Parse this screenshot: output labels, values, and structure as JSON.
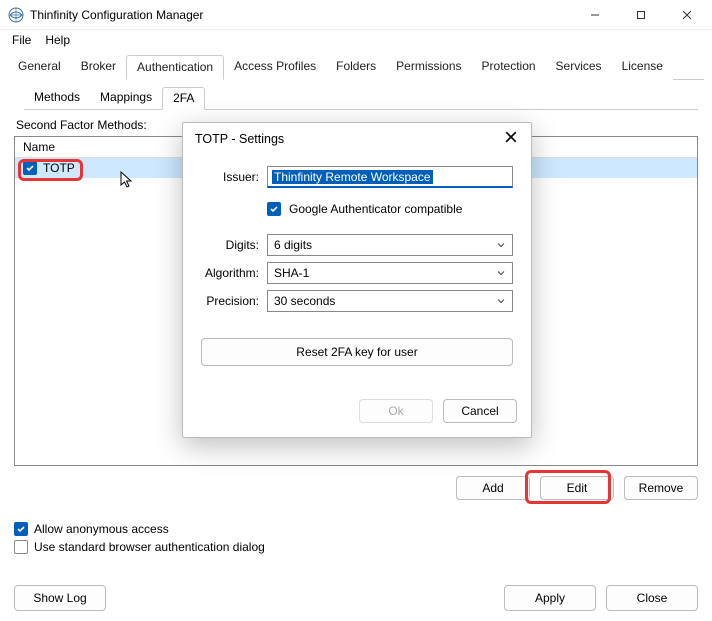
{
  "window": {
    "title": "Thinfinity Configuration Manager"
  },
  "menubar": {
    "file": "File",
    "help": "Help"
  },
  "tabs": {
    "general": "General",
    "broker": "Broker",
    "authentication": "Authentication",
    "access_profiles": "Access Profiles",
    "folders": "Folders",
    "permissions": "Permissions",
    "protection": "Protection",
    "services": "Services",
    "license": "License"
  },
  "subtabs": {
    "methods": "Methods",
    "mappings": "Mappings",
    "two_fa": "2FA"
  },
  "section_label": "Second Factor Methods:",
  "list": {
    "header": "Name",
    "items": [
      "TOTP"
    ]
  },
  "buttons": {
    "add": "Add",
    "edit": "Edit",
    "remove": "Remove",
    "show_log": "Show Log",
    "apply": "Apply",
    "close": "Close"
  },
  "checks": {
    "anon": "Allow anonymous access",
    "std_browser": "Use standard browser authentication dialog"
  },
  "dialog": {
    "title": "TOTP - Settings",
    "labels": {
      "issuer": "Issuer:",
      "google": "Google Authenticator compatible",
      "digits": "Digits:",
      "algorithm": "Algorithm:",
      "precision": "Precision:"
    },
    "values": {
      "issuer": "Thinfinity Remote Workspace",
      "digits": "6 digits",
      "algorithm": "SHA-1",
      "precision": "30 seconds"
    },
    "reset": "Reset 2FA key for user",
    "ok": "Ok",
    "cancel": "Cancel"
  }
}
